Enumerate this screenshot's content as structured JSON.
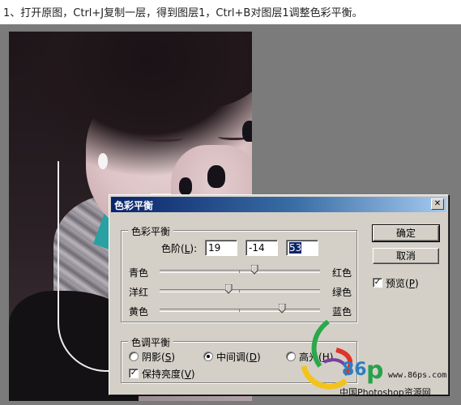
{
  "instruction": "1、打开原图，Ctrl+J复制一层，得到图层1，Ctrl+B对图层1调整色彩平衡。",
  "dialog": {
    "title": "色彩平衡",
    "close_icon": "close-icon",
    "color_balance_group": {
      "legend": "色彩平衡",
      "levels_label": "色阶",
      "levels_shortcut_open": "(",
      "levels_shortcut": "L",
      "levels_shortcut_close": "):",
      "level_values": [
        "19",
        "-14",
        "53"
      ],
      "sliders": [
        {
          "left": "青色",
          "right": "红色",
          "value": 19
        },
        {
          "left": "洋红",
          "right": "绿色",
          "value": -14
        },
        {
          "left": "黄色",
          "right": "蓝色",
          "value": 53
        }
      ]
    },
    "tone_balance_group": {
      "legend": "色调平衡",
      "radios": [
        {
          "label": "阴影",
          "key": "S",
          "selected": false
        },
        {
          "label": "中间调",
          "key": "D",
          "selected": true
        },
        {
          "label": "高光",
          "key": "H",
          "selected": false
        }
      ],
      "preserve_luminosity": {
        "label": "保持亮度",
        "key": "V",
        "checked": true
      }
    },
    "buttons": {
      "ok": "确定",
      "cancel": "取消"
    },
    "preview": {
      "label": "预览",
      "key": "P",
      "checked": true
    }
  },
  "watermark": {
    "brand_number": "86",
    "brand_letter": "p",
    "url": "www.86ps.com",
    "site_name": "中国Photoshop资源网"
  }
}
